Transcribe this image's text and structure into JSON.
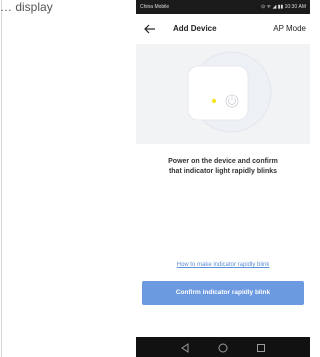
{
  "caption_fragment": "… display",
  "status_bar": {
    "carrier": "China Mobile",
    "right_text": "⊙ ᯤ ◢ ▮▮ 10:30 AM"
  },
  "header": {
    "back_icon": "arrow-left",
    "title": "Add Device",
    "mode": "AP Mode"
  },
  "illustration": {
    "indicator_color": "#f2e52a",
    "icon": "power-button"
  },
  "instruction": {
    "line1": "Power on the device and confirm",
    "line2": "that indicator light rapidly blinks"
  },
  "help_link": "How to make indicator rapidly blink",
  "confirm_button": {
    "label": "Confirm indicator rapidly blink",
    "color": "#6b9ae0"
  },
  "nav": {
    "back_icon": "triangle-back",
    "home_icon": "circle-home",
    "recents_icon": "square-recents"
  }
}
